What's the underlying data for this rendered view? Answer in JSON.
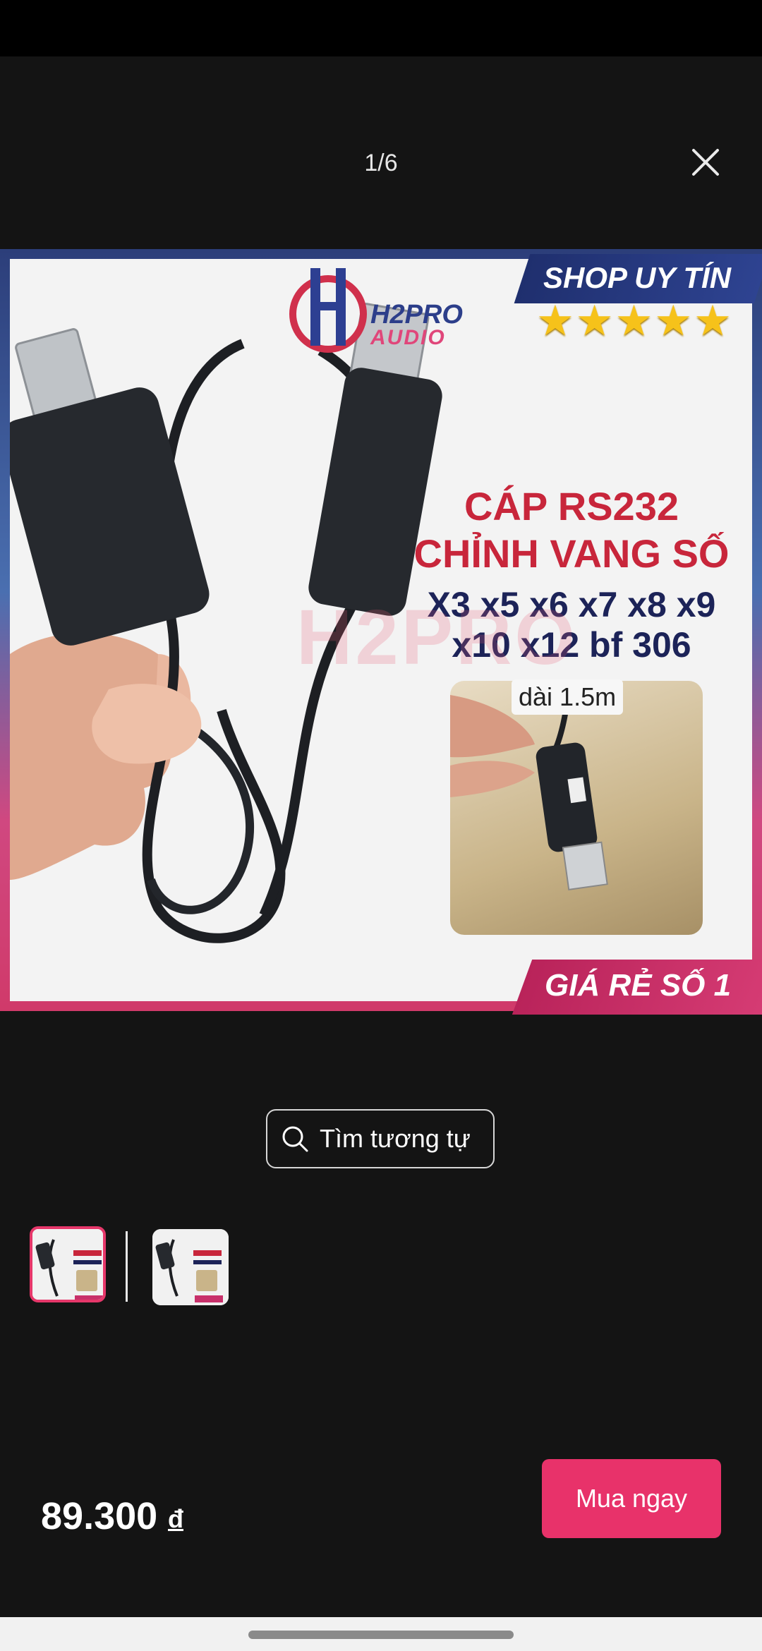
{
  "viewer": {
    "counter": "1/6",
    "close_icon": "close-icon"
  },
  "product_image": {
    "brand_h2": "H2PRO",
    "brand_audio": "AUDIO",
    "shop_badge": "SHOP UY TÍN",
    "stars": "★★★★★",
    "title_line1": "CÁP RS232",
    "title_line2": "CHỈNH VANG SỐ",
    "models_line1": "X3 x5 x6 x7 x8 x9",
    "models_line2": "x10 x12 bf 306",
    "length_label": "dài 1.5m",
    "price_banner": "GIÁ RẺ SỐ 1",
    "watermark": "H2PRO"
  },
  "actions": {
    "similar_label": "Tìm tương tự",
    "similar_icon": "search-icon"
  },
  "footer": {
    "price": "89.300",
    "currency": "đ",
    "buy_label": "Mua ngay"
  },
  "colors": {
    "accent": "#e8326a",
    "background": "#141414"
  }
}
